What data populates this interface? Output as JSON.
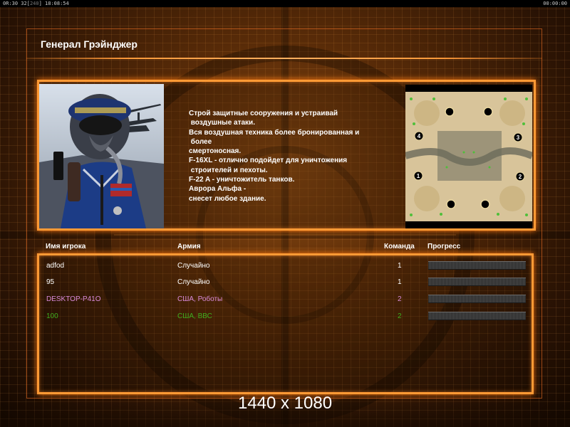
{
  "topbar": {
    "left_prefix": "0R:30 32[",
    "left_dim": "240",
    "left_suffix": "] 18:08:54",
    "right": "00:00:00"
  },
  "general": {
    "title": "Генерал Грэйнджер",
    "description": "Строй защитные сооружения и устраивай\n воздушные атаки.\nВся воздушная техника более бронированная и\n более\nсмертоносная.\nF-16XL - отлично подойдет для уничтожения\n строителей и пехоты.\nF-22 A - уничтожитель танков.\nАврора Альфа -\nснесет любое здание."
  },
  "minimap": {
    "start_positions": [
      "1",
      "2",
      "3",
      "4"
    ]
  },
  "players_table": {
    "headers": {
      "name": "Имя игрока",
      "army": "Армия",
      "team": "Команда",
      "progress": "Прогресс"
    },
    "rows": [
      {
        "name": "adfod",
        "army": "Случайно",
        "team": "1",
        "color": "#ffffff",
        "progress": 0
      },
      {
        "name": "95",
        "army": "Случайно",
        "team": "1",
        "color": "#ffffff",
        "progress": 0
      },
      {
        "name": "DESKTOP-P41O",
        "army": "США, Роботы",
        "team": "2",
        "color": "#d88ad8",
        "progress": 0
      },
      {
        "name": "100",
        "army": "США, ВВС",
        "team": "2",
        "color": "#3fae1f",
        "progress": 0
      }
    ]
  },
  "resolution_label": "1440 x 1080",
  "colors": {
    "accent": "#ff9a35",
    "player_white": "#ffffff",
    "player_purple": "#d88ad8",
    "player_green": "#3fae1f"
  },
  "icons": [
    "general-portrait",
    "minimap",
    "progress-bar"
  ]
}
